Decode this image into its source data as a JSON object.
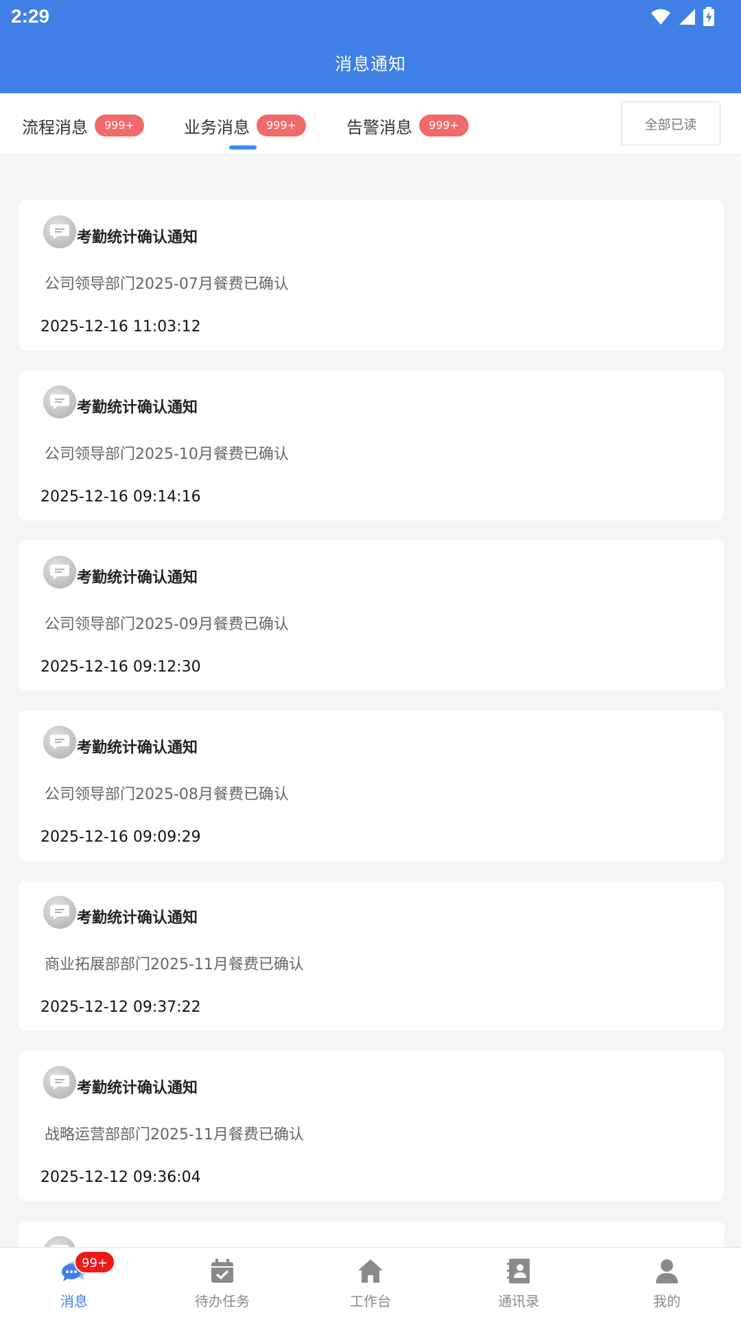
{
  "status_bar": {
    "time": "2:29"
  },
  "header": {
    "title": "消息通知"
  },
  "tabs": [
    {
      "label": "流程消息",
      "badge": "999+"
    },
    {
      "label": "业务消息",
      "badge": "999+",
      "active": true
    },
    {
      "label": "告警消息",
      "badge": "999+"
    }
  ],
  "mark_all_read_label": "全部已读",
  "messages": [
    {
      "title": "考勤统计确认通知",
      "content": "公司领导部门2025-07月餐费已确认",
      "time": "2025-12-16 11:03:12"
    },
    {
      "title": "考勤统计确认通知",
      "content": "公司领导部门2025-10月餐费已确认",
      "time": "2025-12-16 09:14:16"
    },
    {
      "title": "考勤统计确认通知",
      "content": "公司领导部门2025-09月餐费已确认",
      "time": "2025-12-16 09:12:30"
    },
    {
      "title": "考勤统计确认通知",
      "content": "公司领导部门2025-08月餐费已确认",
      "time": "2025-12-16 09:09:29"
    },
    {
      "title": "考勤统计确认通知",
      "content": "商业拓展部部门2025-11月餐费已确认",
      "time": "2025-12-12 09:37:22"
    },
    {
      "title": "考勤统计确认通知",
      "content": "战略运营部部门2025-11月餐费已确认",
      "time": "2025-12-12 09:36:04"
    }
  ],
  "bottom_nav": [
    {
      "label": "消息",
      "icon": "chat-bubbles-icon",
      "badge": "99+",
      "active": true
    },
    {
      "label": "待办任务",
      "icon": "calendar-check-icon"
    },
    {
      "label": "工作台",
      "icon": "home-icon"
    },
    {
      "label": "通讯录",
      "icon": "contact-book-icon"
    },
    {
      "label": "我的",
      "icon": "user-icon"
    }
  ],
  "colors": {
    "primary": "#3f7fe6",
    "badge_red": "#f06a6a",
    "nav_badge_red": "#f01818",
    "tab_indicator": "#3a8ef5"
  }
}
